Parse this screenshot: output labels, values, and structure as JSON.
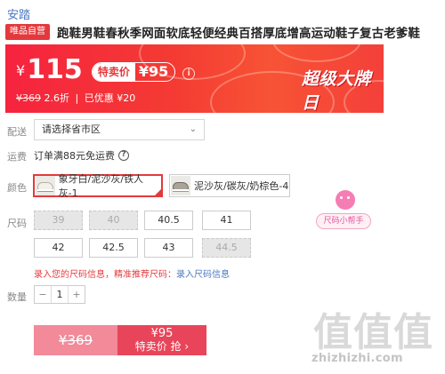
{
  "brand": "安踏",
  "title": {
    "tag": "唯品自营",
    "text": "跑鞋男鞋春秋季网面软底轻便经典百搭厚底增高运动鞋子复古老爹鞋"
  },
  "price_banner": {
    "currency": "¥",
    "price": "115",
    "tejia_label": "特卖价",
    "tejia_price": "¥95",
    "info_icon": "info-icon",
    "original_price": "¥369",
    "discount": "2.6折",
    "saved": "已优惠 ¥20",
    "promo": "超级大牌日",
    "colors": {
      "primary": "#f6233f",
      "accent": "#ffffff"
    }
  },
  "delivery": {
    "label": "配送",
    "placeholder": "请选择省市区"
  },
  "shipping": {
    "label": "运费",
    "text": "订单满88元免运费"
  },
  "color": {
    "label": "颜色",
    "options": [
      {
        "label": "象牙白/泥沙灰/铁人灰-1",
        "selected": true
      },
      {
        "label": "泥沙灰/碳灰/奶棕色-4",
        "selected": false
      }
    ]
  },
  "size": {
    "label": "尺码",
    "options": [
      {
        "value": "39",
        "disabled": true
      },
      {
        "value": "40",
        "disabled": true
      },
      {
        "value": "40.5",
        "disabled": false
      },
      {
        "value": "41",
        "disabled": false
      },
      {
        "value": "42",
        "disabled": false
      },
      {
        "value": "42.5",
        "disabled": false
      },
      {
        "value": "43",
        "disabled": false
      },
      {
        "value": "44.5",
        "disabled": true
      }
    ],
    "helper": "尺码小帮手",
    "tip_text": "录入您的尺码信息，精准推荐尺码：",
    "tip_link": "录入尺码信息"
  },
  "quantity": {
    "label": "数量",
    "minus": "−",
    "value": "1",
    "plus": "+"
  },
  "buy": {
    "original": "¥369",
    "price": "¥95",
    "action": "特卖价 抢 ›"
  },
  "watermark": {
    "glyphs": "值值值",
    "url": "zhizhizhi.com"
  }
}
